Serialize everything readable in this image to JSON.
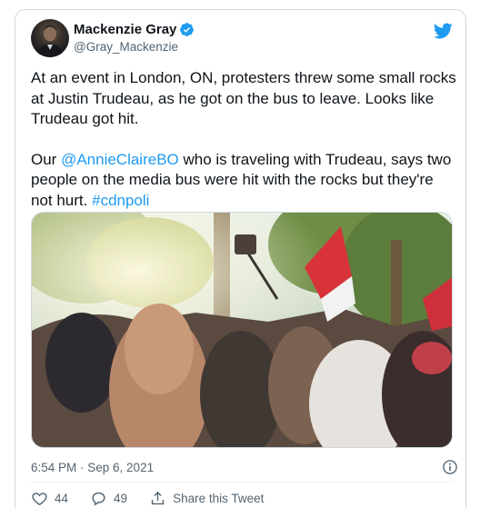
{
  "author": {
    "display_name": "Mackenzie Gray",
    "handle": "@Gray_Mackenzie",
    "verified": true
  },
  "tweet": {
    "paragraph1": "At an event in London, ON, protesters threw some small rocks at Justin Trudeau, as he got on the bus to leave. Looks like Trudeau got hit.",
    "p2_prefix": "Our ",
    "p2_mention": "@AnnieClaireBO",
    "p2_middle": " who is traveling with Trudeau, says two people on the media bus were hit with the rocks but they're not hurt. ",
    "p2_hashtag": "#cdnpoli"
  },
  "timestamp": "6:54 PM · Sep 6, 2021",
  "actions": {
    "likes": "44",
    "replies": "49",
    "share_label": "Share this Tweet"
  },
  "icons": {
    "verified": "verified-badge-icon",
    "brand": "twitter-bird-icon",
    "info": "info-icon",
    "like": "heart-icon",
    "reply": "reply-bubble-icon",
    "share": "share-icon"
  },
  "colors": {
    "accent": "#1d9bf0",
    "text": "#0f1419",
    "secondary": "#536471",
    "border": "#cfd9de"
  }
}
